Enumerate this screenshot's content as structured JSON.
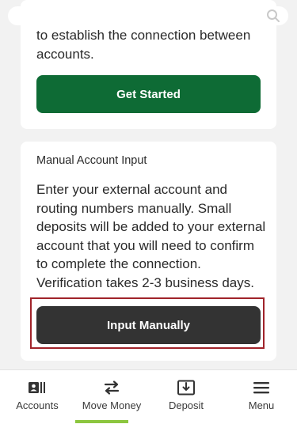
{
  "search": {
    "placeholder": ""
  },
  "card_auto": {
    "text": "to establish the connection between accounts.",
    "button_label": "Get Started"
  },
  "card_manual": {
    "title": "Manual Account Input",
    "text": "Enter your external account and routing numbers manually. Small deposits will be added to your external account that you will need to confirm to complete the connection. Verification takes 2-3 business days.",
    "button_label": "Input Manually"
  },
  "nav": {
    "items": [
      {
        "label": "Accounts",
        "icon": "accounts-icon"
      },
      {
        "label": "Move Money",
        "icon": "transfer-icon",
        "active": true
      },
      {
        "label": "Deposit",
        "icon": "deposit-icon"
      },
      {
        "label": "Menu",
        "icon": "hamburger-menu-icon"
      }
    ]
  },
  "colors": {
    "primary_green": "#0e6b35",
    "dark_button": "#333333",
    "highlight_border": "#a0232a",
    "active_tab": "#8cc63f"
  }
}
